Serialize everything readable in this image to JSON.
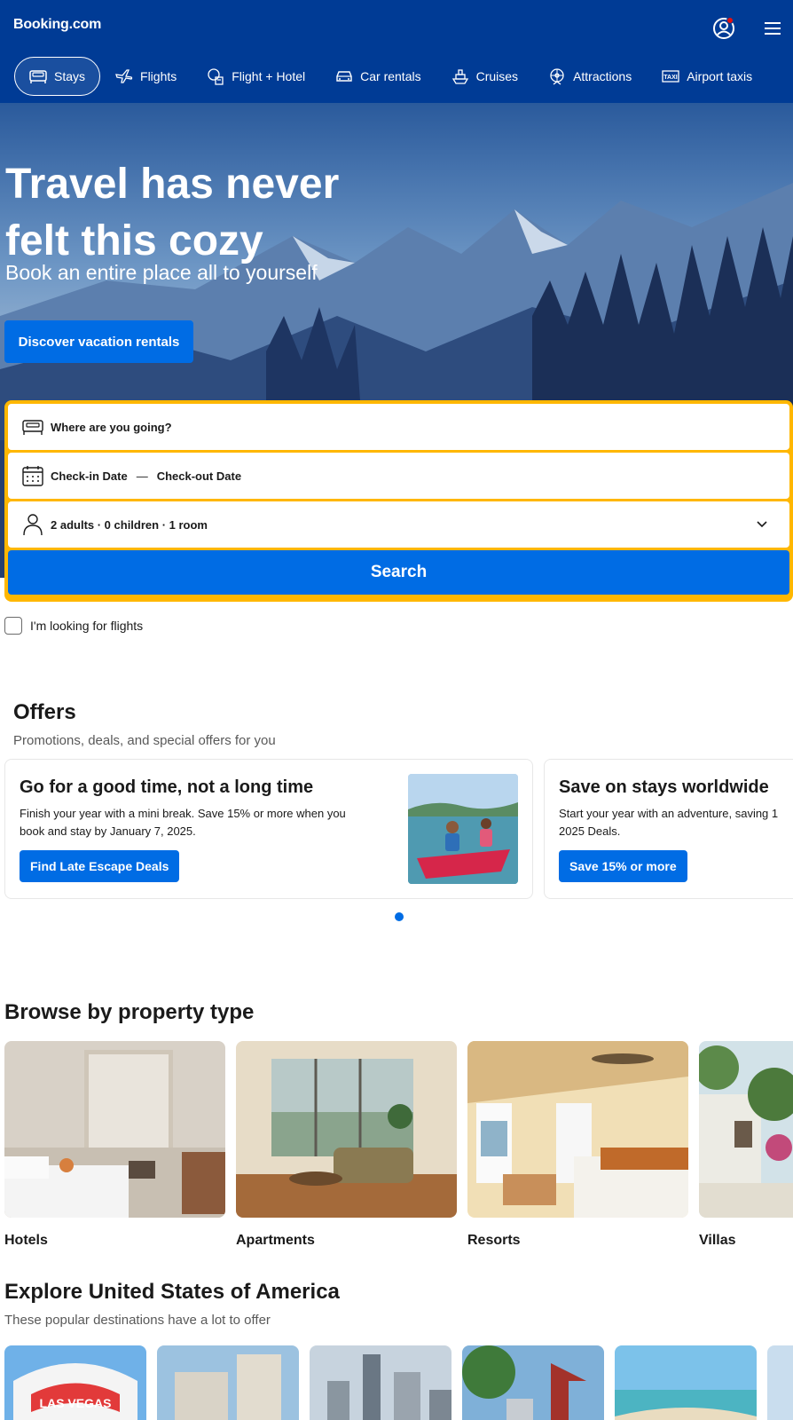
{
  "header": {
    "logo": "Booking.com",
    "nav": [
      {
        "label": "Stays",
        "icon": "bed-icon",
        "active": true
      },
      {
        "label": "Flights",
        "icon": "plane-icon"
      },
      {
        "label": "Flight + Hotel",
        "icon": "flight-hotel-icon"
      },
      {
        "label": "Car rentals",
        "icon": "car-icon"
      },
      {
        "label": "Cruises",
        "icon": "ship-icon"
      },
      {
        "label": "Attractions",
        "icon": "attractions-icon"
      },
      {
        "label": "Airport taxis",
        "icon": "taxi-icon"
      }
    ]
  },
  "hero": {
    "title": "Travel has never felt this cozy",
    "subtitle": "Book an entire place all to yourself",
    "button": "Discover vacation rentals"
  },
  "search": {
    "destination_placeholder": "Where are you going?",
    "checkin": "Check-in Date",
    "separator": "—",
    "checkout": "Check-out Date",
    "occupancy": "2 adults · 0 children · 1 room",
    "button": "Search",
    "flights_checkbox": "I'm looking for flights"
  },
  "offers": {
    "title": "Offers",
    "subtitle": "Promotions, deals, and special offers for you",
    "cards": [
      {
        "title": "Go for a good time, not a long time",
        "text1": "Finish your year with a mini break. Save 15% or more when you",
        "text2": "book and stay by January 7, 2025.",
        "button": "Find Late Escape Deals"
      },
      {
        "title": "Save on stays worldwide",
        "text1": "Start your year with an adventure, saving 1",
        "text2": "2025 Deals.",
        "button": "Save 15% or more"
      }
    ]
  },
  "property_types": {
    "title": "Browse by property type",
    "items": [
      "Hotels",
      "Apartments",
      "Resorts",
      "Villas"
    ]
  },
  "explore": {
    "title": "Explore United States of America",
    "subtitle": "These popular destinations have a lot to offer",
    "first_card_text": "LAS VEGAS"
  },
  "colors": {
    "brand_blue": "#003b95",
    "action_blue": "#006ce4",
    "search_border": "#ffb700"
  }
}
